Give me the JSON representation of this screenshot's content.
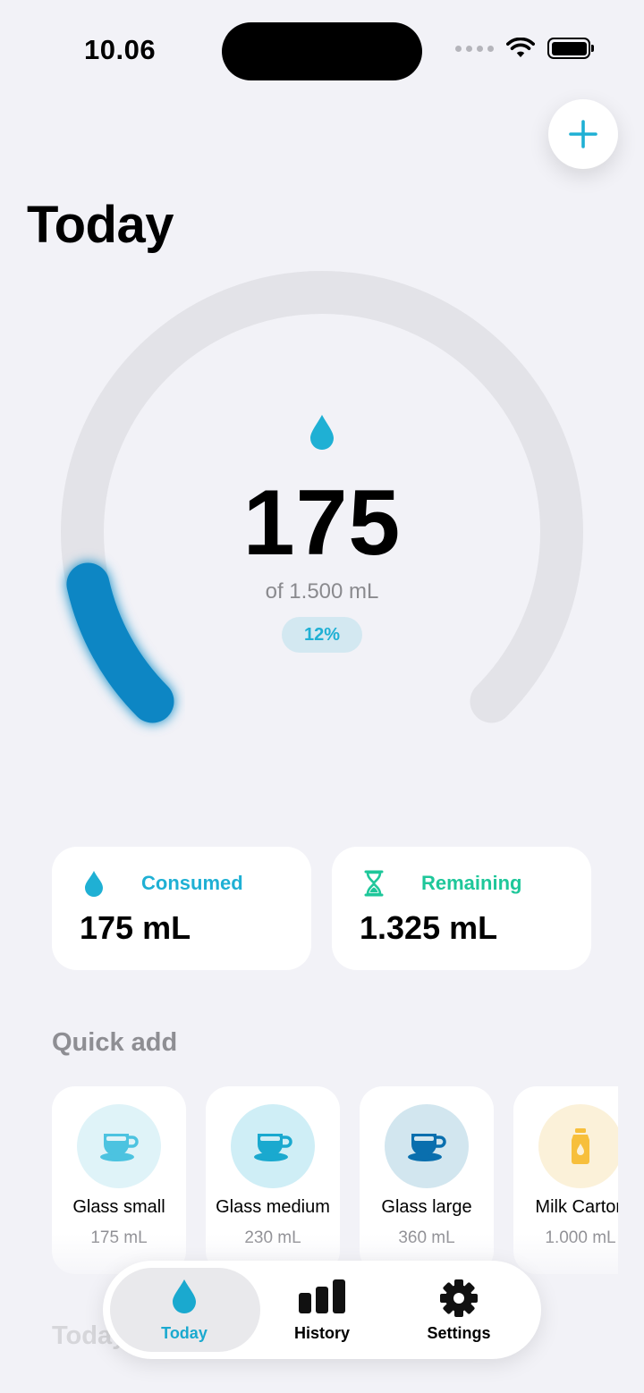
{
  "status_bar": {
    "time": "10.06"
  },
  "header": {
    "title": "Today"
  },
  "colors": {
    "accent": "#1fb0d4",
    "ring_progress": "#0a86c4",
    "ring_track": "#e3e3e8",
    "remaining": "#1ec79a"
  },
  "progress": {
    "value": "175",
    "goal_text": "of 1.500 mL",
    "percent_label": "12%",
    "fraction": 0.12,
    "icon": "water-drop-icon"
  },
  "stats": [
    {
      "label": "Consumed",
      "value": "175 mL",
      "icon": "water-drop-icon"
    },
    {
      "label": "Remaining",
      "value": "1.325 mL",
      "icon": "hourglass-icon"
    }
  ],
  "quick_add": {
    "title": "Quick add",
    "items": [
      {
        "name": "Glass small",
        "amount": "175 mL",
        "icon": "cup-icon"
      },
      {
        "name": "Glass medium",
        "amount": "230 mL",
        "icon": "cup-icon"
      },
      {
        "name": "Glass large",
        "amount": "360 mL",
        "icon": "cup-icon"
      },
      {
        "name": "Milk Carton",
        "amount": "1.000 mL",
        "icon": "milk-carton-icon"
      }
    ]
  },
  "log_section": {
    "title": "Today"
  },
  "tabs": [
    {
      "label": "Today",
      "icon": "water-drop-icon",
      "active": true
    },
    {
      "label": "History",
      "icon": "bar-chart-icon",
      "active": false
    },
    {
      "label": "Settings",
      "icon": "gear-icon",
      "active": false
    }
  ]
}
